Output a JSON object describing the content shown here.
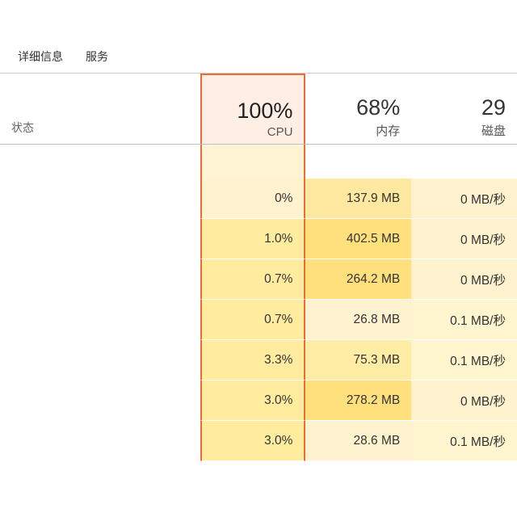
{
  "tabs": {
    "details": "详细信息",
    "services": "服务"
  },
  "headers": {
    "status": "状态",
    "cpu": {
      "percent": "100%",
      "label": "CPU"
    },
    "memory": {
      "percent": "68%",
      "label": "内存"
    },
    "disk": {
      "percent": "29",
      "label": "磁盘"
    }
  },
  "rows": [
    {
      "cpu": "0%",
      "mem": "137.9 MB",
      "disk": "0 MB/秒"
    },
    {
      "cpu": "1.0%",
      "mem": "402.5 MB",
      "disk": "0 MB/秒"
    },
    {
      "cpu": "0.7%",
      "mem": "264.2 MB",
      "disk": "0 MB/秒"
    },
    {
      "cpu": "0.7%",
      "mem": "26.8 MB",
      "disk": "0.1 MB/秒"
    },
    {
      "cpu": "3.3%",
      "mem": "75.3 MB",
      "disk": "0.1 MB/秒"
    },
    {
      "cpu": "3.0%",
      "mem": "278.2 MB",
      "disk": "0 MB/秒"
    },
    {
      "cpu": "3.0%",
      "mem": "28.6 MB",
      "disk": "0.1 MB/秒"
    }
  ]
}
